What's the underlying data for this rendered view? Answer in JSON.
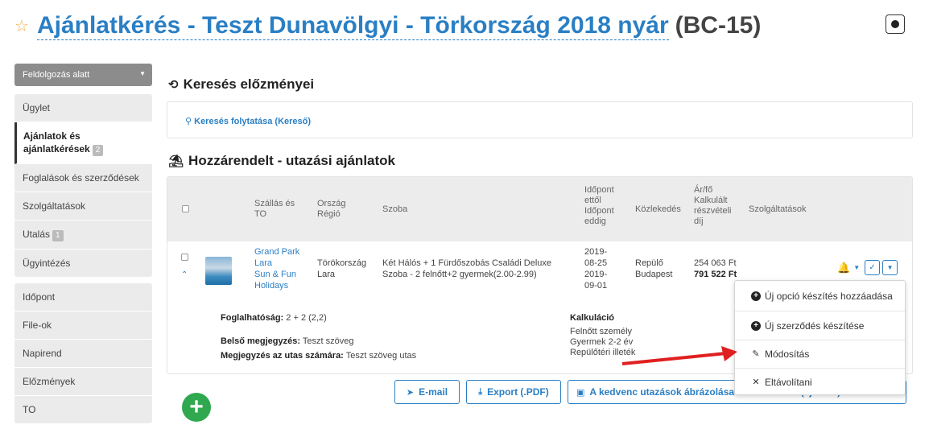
{
  "header": {
    "title": "Ajánlatkérés - Teszt Dunavölgyi - Törkország 2018 nyár",
    "code": "(BC-15)"
  },
  "status": {
    "selected": "Feldolgozás alatt"
  },
  "sidebar": {
    "group1": [
      {
        "label": "Ügylet"
      },
      {
        "label": "Ajánlatok és ajánlatkérések",
        "badge": "2"
      },
      {
        "label": "Foglalások és szerződések"
      },
      {
        "label": "Szolgáltatások"
      },
      {
        "label": "Utalás",
        "badge": "1"
      },
      {
        "label": "Ügyintézés"
      }
    ],
    "group2": [
      {
        "label": "Időpont"
      },
      {
        "label": "File-ok"
      },
      {
        "label": "Napirend"
      },
      {
        "label": "Előzmények"
      },
      {
        "label": "TO"
      }
    ]
  },
  "history": {
    "title": "Keresés előzményei",
    "link": "Keresés folytatása (Kereső)"
  },
  "offers": {
    "title": "Hozzárendelt - utazási ajánlatok",
    "columns": {
      "stay_to_1": "Szállás és",
      "stay_to_2": "TO",
      "country_1": "Ország",
      "country_2": "Régió",
      "room": "Szoba",
      "date_1": "Időpont",
      "date_2": "ettől",
      "date_3": "Időpont",
      "date_4": "eddig",
      "transport": "Közlekedés",
      "price_1": "Ár/fő",
      "price_2": "Kalkulált",
      "price_3": "részvételi",
      "price_4": "díj",
      "services": "Szolgáltatások"
    },
    "row": {
      "hotel_1": "Grand Park",
      "hotel_2": "Lara",
      "hotel_3": "Sun & Fun",
      "hotel_4": "Holidays",
      "country": "Törökország",
      "region": "Lara",
      "room_1": "Két Hálós + 1 Fürdőszobás Családi Deluxe",
      "room_2": "Szoba - 2 felnőtt+2 gyermek(2.00-2.99)",
      "from_1": "2019-",
      "from_2": "08-25",
      "to_1": "2019-",
      "to_2": "09-01",
      "transport_1": "Repülő",
      "transport_2": "Budapest",
      "price_per": "254 063 Ft",
      "price_total": "791 522 Ft"
    },
    "details": {
      "bookable_label": "Foglalhatóság:",
      "bookable_value": "2 + 2 (2,2)",
      "internal_label": "Belső megjegyzés:",
      "internal_value": "Teszt szöveg",
      "traveller_label": "Megjegyzés az utas számára:",
      "traveller_value": "Teszt szöveg utas",
      "calc_title": "Kalkuláció",
      "calc_1": "Felnőtt személy",
      "calc_2": "Gyermek 2-2 év",
      "calc_3": "Repülőtéri illeték"
    }
  },
  "dropdown": {
    "items": [
      {
        "label": "Új opció készítés hozzáadása",
        "icon": "plus-circle-icon"
      },
      {
        "label": "Új szerződés készítése",
        "icon": "plus-circle-icon"
      },
      {
        "label": "Módosítás",
        "icon": "pencil-icon"
      },
      {
        "label": "Eltávolítani",
        "icon": "close-icon"
      }
    ]
  },
  "buttons": {
    "email": "E-mail",
    "export": "Export (.PDF)",
    "favorites": "A kedvenc utazások ábrázolása a weboldalon (ajánlati)"
  },
  "colors": {
    "accent": "#2a7fc4",
    "add": "#2fa84f",
    "arrow": "#e02020",
    "sidebar_bg": "#ebebeb"
  }
}
